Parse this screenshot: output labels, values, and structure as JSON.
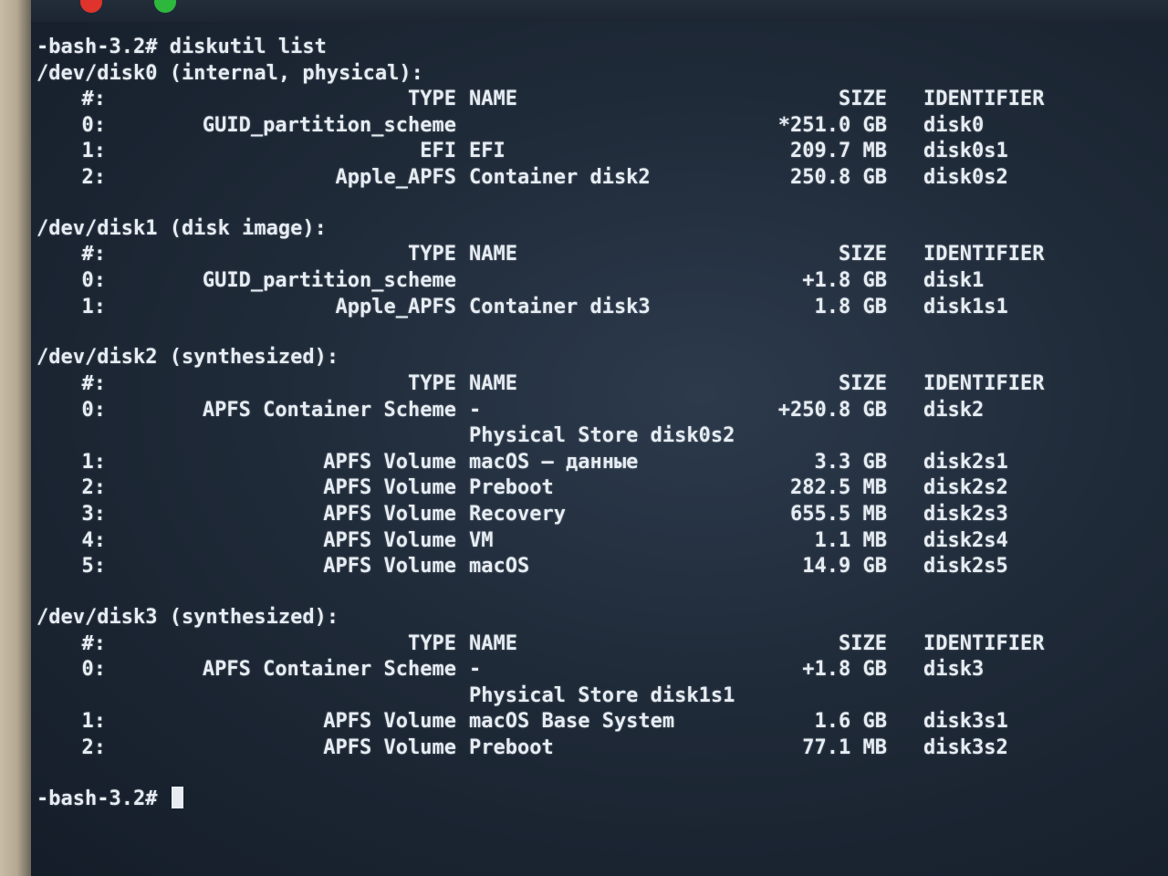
{
  "window": {
    "buttons": [
      {
        "name": "close",
        "color": "#e0332c"
      },
      {
        "name": "zoom",
        "color": "#2db83d"
      }
    ]
  },
  "terminal": {
    "command_line": "-bash-3.2# diskutil list",
    "disks": [
      {
        "header": "/dev/disk0 (internal, physical):",
        "columns": {
          "num": "#:",
          "type": "TYPE",
          "name": "NAME",
          "size": "SIZE",
          "identifier": "IDENTIFIER"
        },
        "rows": [
          {
            "num": "0:",
            "type": "GUID_partition_scheme",
            "name": "",
            "size": "*251.0 GB",
            "identifier": "disk0"
          },
          {
            "num": "1:",
            "type": "EFI",
            "name": "EFI",
            "size": "209.7 MB",
            "identifier": "disk0s1"
          },
          {
            "num": "2:",
            "type": "Apple_APFS",
            "name": "Container disk2",
            "size": "250.8 GB",
            "identifier": "disk0s2"
          }
        ]
      },
      {
        "header": "/dev/disk1 (disk image):",
        "columns": {
          "num": "#:",
          "type": "TYPE",
          "name": "NAME",
          "size": "SIZE",
          "identifier": "IDENTIFIER"
        },
        "rows": [
          {
            "num": "0:",
            "type": "GUID_partition_scheme",
            "name": "",
            "size": "+1.8 GB",
            "identifier": "disk1"
          },
          {
            "num": "1:",
            "type": "Apple_APFS",
            "name": "Container disk3",
            "size": "1.8 GB",
            "identifier": "disk1s1"
          }
        ]
      },
      {
        "header": "/dev/disk2 (synthesized):",
        "columns": {
          "num": "#:",
          "type": "TYPE",
          "name": "NAME",
          "size": "SIZE",
          "identifier": "IDENTIFIER"
        },
        "rows": [
          {
            "num": "0:",
            "type": "APFS Container Scheme",
            "name": "-",
            "size": "+250.8 GB",
            "identifier": "disk2"
          },
          {
            "num": "",
            "type": "",
            "name": "Physical Store disk0s2",
            "size": "",
            "identifier": ""
          },
          {
            "num": "1:",
            "type": "APFS Volume",
            "name": "macOS — данные",
            "size": "3.3 GB",
            "identifier": "disk2s1"
          },
          {
            "num": "2:",
            "type": "APFS Volume",
            "name": "Preboot",
            "size": "282.5 MB",
            "identifier": "disk2s2"
          },
          {
            "num": "3:",
            "type": "APFS Volume",
            "name": "Recovery",
            "size": "655.5 MB",
            "identifier": "disk2s3"
          },
          {
            "num": "4:",
            "type": "APFS Volume",
            "name": "VM",
            "size": "1.1 MB",
            "identifier": "disk2s4"
          },
          {
            "num": "5:",
            "type": "APFS Volume",
            "name": "macOS",
            "size": "14.9 GB",
            "identifier": "disk2s5"
          }
        ]
      },
      {
        "header": "/dev/disk3 (synthesized):",
        "columns": {
          "num": "#:",
          "type": "TYPE",
          "name": "NAME",
          "size": "SIZE",
          "identifier": "IDENTIFIER"
        },
        "rows": [
          {
            "num": "0:",
            "type": "APFS Container Scheme",
            "name": "-",
            "size": "+1.8 GB",
            "identifier": "disk3"
          },
          {
            "num": "",
            "type": "",
            "name": "Physical Store disk1s1",
            "size": "",
            "identifier": ""
          },
          {
            "num": "1:",
            "type": "APFS Volume",
            "name": "macOS Base System",
            "size": "1.6 GB",
            "identifier": "disk3s1"
          },
          {
            "num": "2:",
            "type": "APFS Volume",
            "name": "Preboot",
            "size": "77.1 MB",
            "identifier": "disk3s2"
          }
        ]
      }
    ],
    "prompt": "-bash-3.2#"
  }
}
